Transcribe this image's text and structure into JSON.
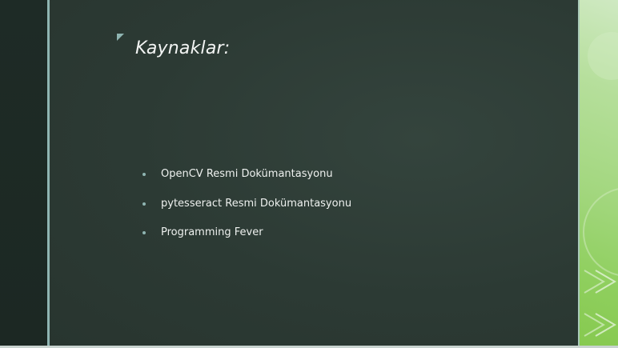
{
  "slide": {
    "title": "Kaynaklar:",
    "bullets": [
      "OpenCV Resmi Dokümantasyonu",
      "pytesseract Resmi Dokümantasyonu",
      "Programming Fever"
    ]
  },
  "colors": {
    "background": "#2c3a34",
    "accent": "#8fb5b2",
    "text": "#eef1ef",
    "side_panel": "#a3d77f"
  }
}
